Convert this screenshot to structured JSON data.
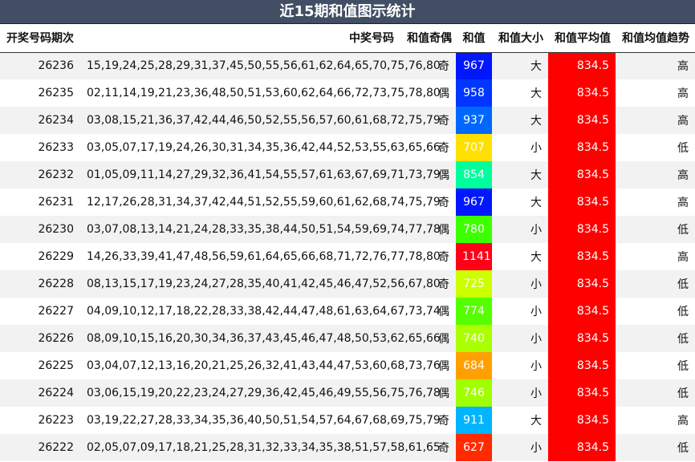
{
  "title": "近15期和值图示统计",
  "headers": {
    "issue": "开奖号码期次",
    "numbers": "中奖号码",
    "parity": "和值奇偶",
    "sum": "和值",
    "size": "和值大小",
    "avg": "和值平均值",
    "trend": "和值均值趋势"
  },
  "colors": {
    "title_bg": "#414e63",
    "avg_bg": "#ff0000"
  },
  "rows": [
    {
      "issue": "26236",
      "numbers": "15,19,24,25,28,29,31,37,45,50,55,56,61,62,64,65,70,75,76,80",
      "parity": "奇",
      "sum": "967",
      "sum_color": "#0017ff",
      "size": "大",
      "avg": "834.5",
      "trend": "高"
    },
    {
      "issue": "26235",
      "numbers": "02,11,14,19,21,23,36,48,50,51,53,60,62,64,66,72,73,75,78,80",
      "parity": "偶",
      "sum": "958",
      "sum_color": "#0036ff",
      "size": "大",
      "avg": "834.5",
      "trend": "高"
    },
    {
      "issue": "26234",
      "numbers": "03,08,15,21,36,37,42,44,46,50,52,55,56,57,60,61,68,72,75,79",
      "parity": "奇",
      "sum": "937",
      "sum_color": "#0068ff",
      "size": "大",
      "avg": "834.5",
      "trend": "高"
    },
    {
      "issue": "26233",
      "numbers": "03,05,07,17,19,24,26,30,31,34,35,36,42,44,52,53,55,63,65,66",
      "parity": "奇",
      "sum": "707",
      "sum_color": "#ffe000",
      "size": "小",
      "avg": "834.5",
      "trend": "低"
    },
    {
      "issue": "26232",
      "numbers": "01,05,09,11,14,27,29,32,36,41,54,55,57,61,63,67,69,71,73,79",
      "parity": "偶",
      "sum": "854",
      "sum_color": "#00ff9c",
      "size": "大",
      "avg": "834.5",
      "trend": "高"
    },
    {
      "issue": "26231",
      "numbers": "12,17,26,28,31,34,37,42,44,51,52,55,59,60,61,62,68,74,75,79",
      "parity": "奇",
      "sum": "967",
      "sum_color": "#0017ff",
      "size": "大",
      "avg": "834.5",
      "trend": "高"
    },
    {
      "issue": "26230",
      "numbers": "03,07,08,13,14,21,24,28,33,35,38,44,50,51,54,59,69,74,77,78",
      "parity": "偶",
      "sum": "780",
      "sum_color": "#3cff00",
      "size": "小",
      "avg": "834.5",
      "trend": "低"
    },
    {
      "issue": "26229",
      "numbers": "14,26,33,39,41,47,48,56,59,61,64,65,66,68,71,72,76,77,78,80",
      "parity": "奇",
      "sum": "1141",
      "sum_color": "#ff0018",
      "size": "大",
      "avg": "834.5",
      "trend": "高"
    },
    {
      "issue": "26228",
      "numbers": "08,13,15,17,19,23,24,27,28,35,40,41,42,45,46,47,52,56,67,80",
      "parity": "奇",
      "sum": "725",
      "sum_color": "#ccff00",
      "size": "小",
      "avg": "834.5",
      "trend": "低"
    },
    {
      "issue": "26227",
      "numbers": "04,09,10,12,17,18,22,28,33,38,42,44,47,48,61,63,64,67,73,74",
      "parity": "偶",
      "sum": "774",
      "sum_color": "#55ff00",
      "size": "小",
      "avg": "834.5",
      "trend": "低"
    },
    {
      "issue": "26226",
      "numbers": "08,09,10,15,16,20,30,34,36,37,43,45,46,47,48,50,53,62,65,66",
      "parity": "偶",
      "sum": "740",
      "sum_color": "#aaff00",
      "size": "小",
      "avg": "834.5",
      "trend": "低"
    },
    {
      "issue": "26225",
      "numbers": "03,04,07,12,13,16,20,21,25,26,32,41,43,44,47,53,60,68,73,76",
      "parity": "偶",
      "sum": "684",
      "sum_color": "#ffa000",
      "size": "小",
      "avg": "834.5",
      "trend": "低"
    },
    {
      "issue": "26224",
      "numbers": "03,06,15,19,20,22,23,24,27,29,36,42,45,46,49,55,56,75,76,78",
      "parity": "偶",
      "sum": "746",
      "sum_color": "#a0ff00",
      "size": "小",
      "avg": "834.5",
      "trend": "低"
    },
    {
      "issue": "26223",
      "numbers": "03,19,22,27,28,33,34,35,36,40,50,51,54,57,64,67,68,69,75,79",
      "parity": "奇",
      "sum": "911",
      "sum_color": "#00b4ff",
      "size": "大",
      "avg": "834.5",
      "trend": "高"
    },
    {
      "issue": "26222",
      "numbers": "02,05,07,09,17,18,21,25,28,31,32,33,34,35,38,51,57,58,61,65",
      "parity": "奇",
      "sum": "627",
      "sum_color": "#ff2a00",
      "size": "小",
      "avg": "834.5",
      "trend": "低"
    }
  ]
}
